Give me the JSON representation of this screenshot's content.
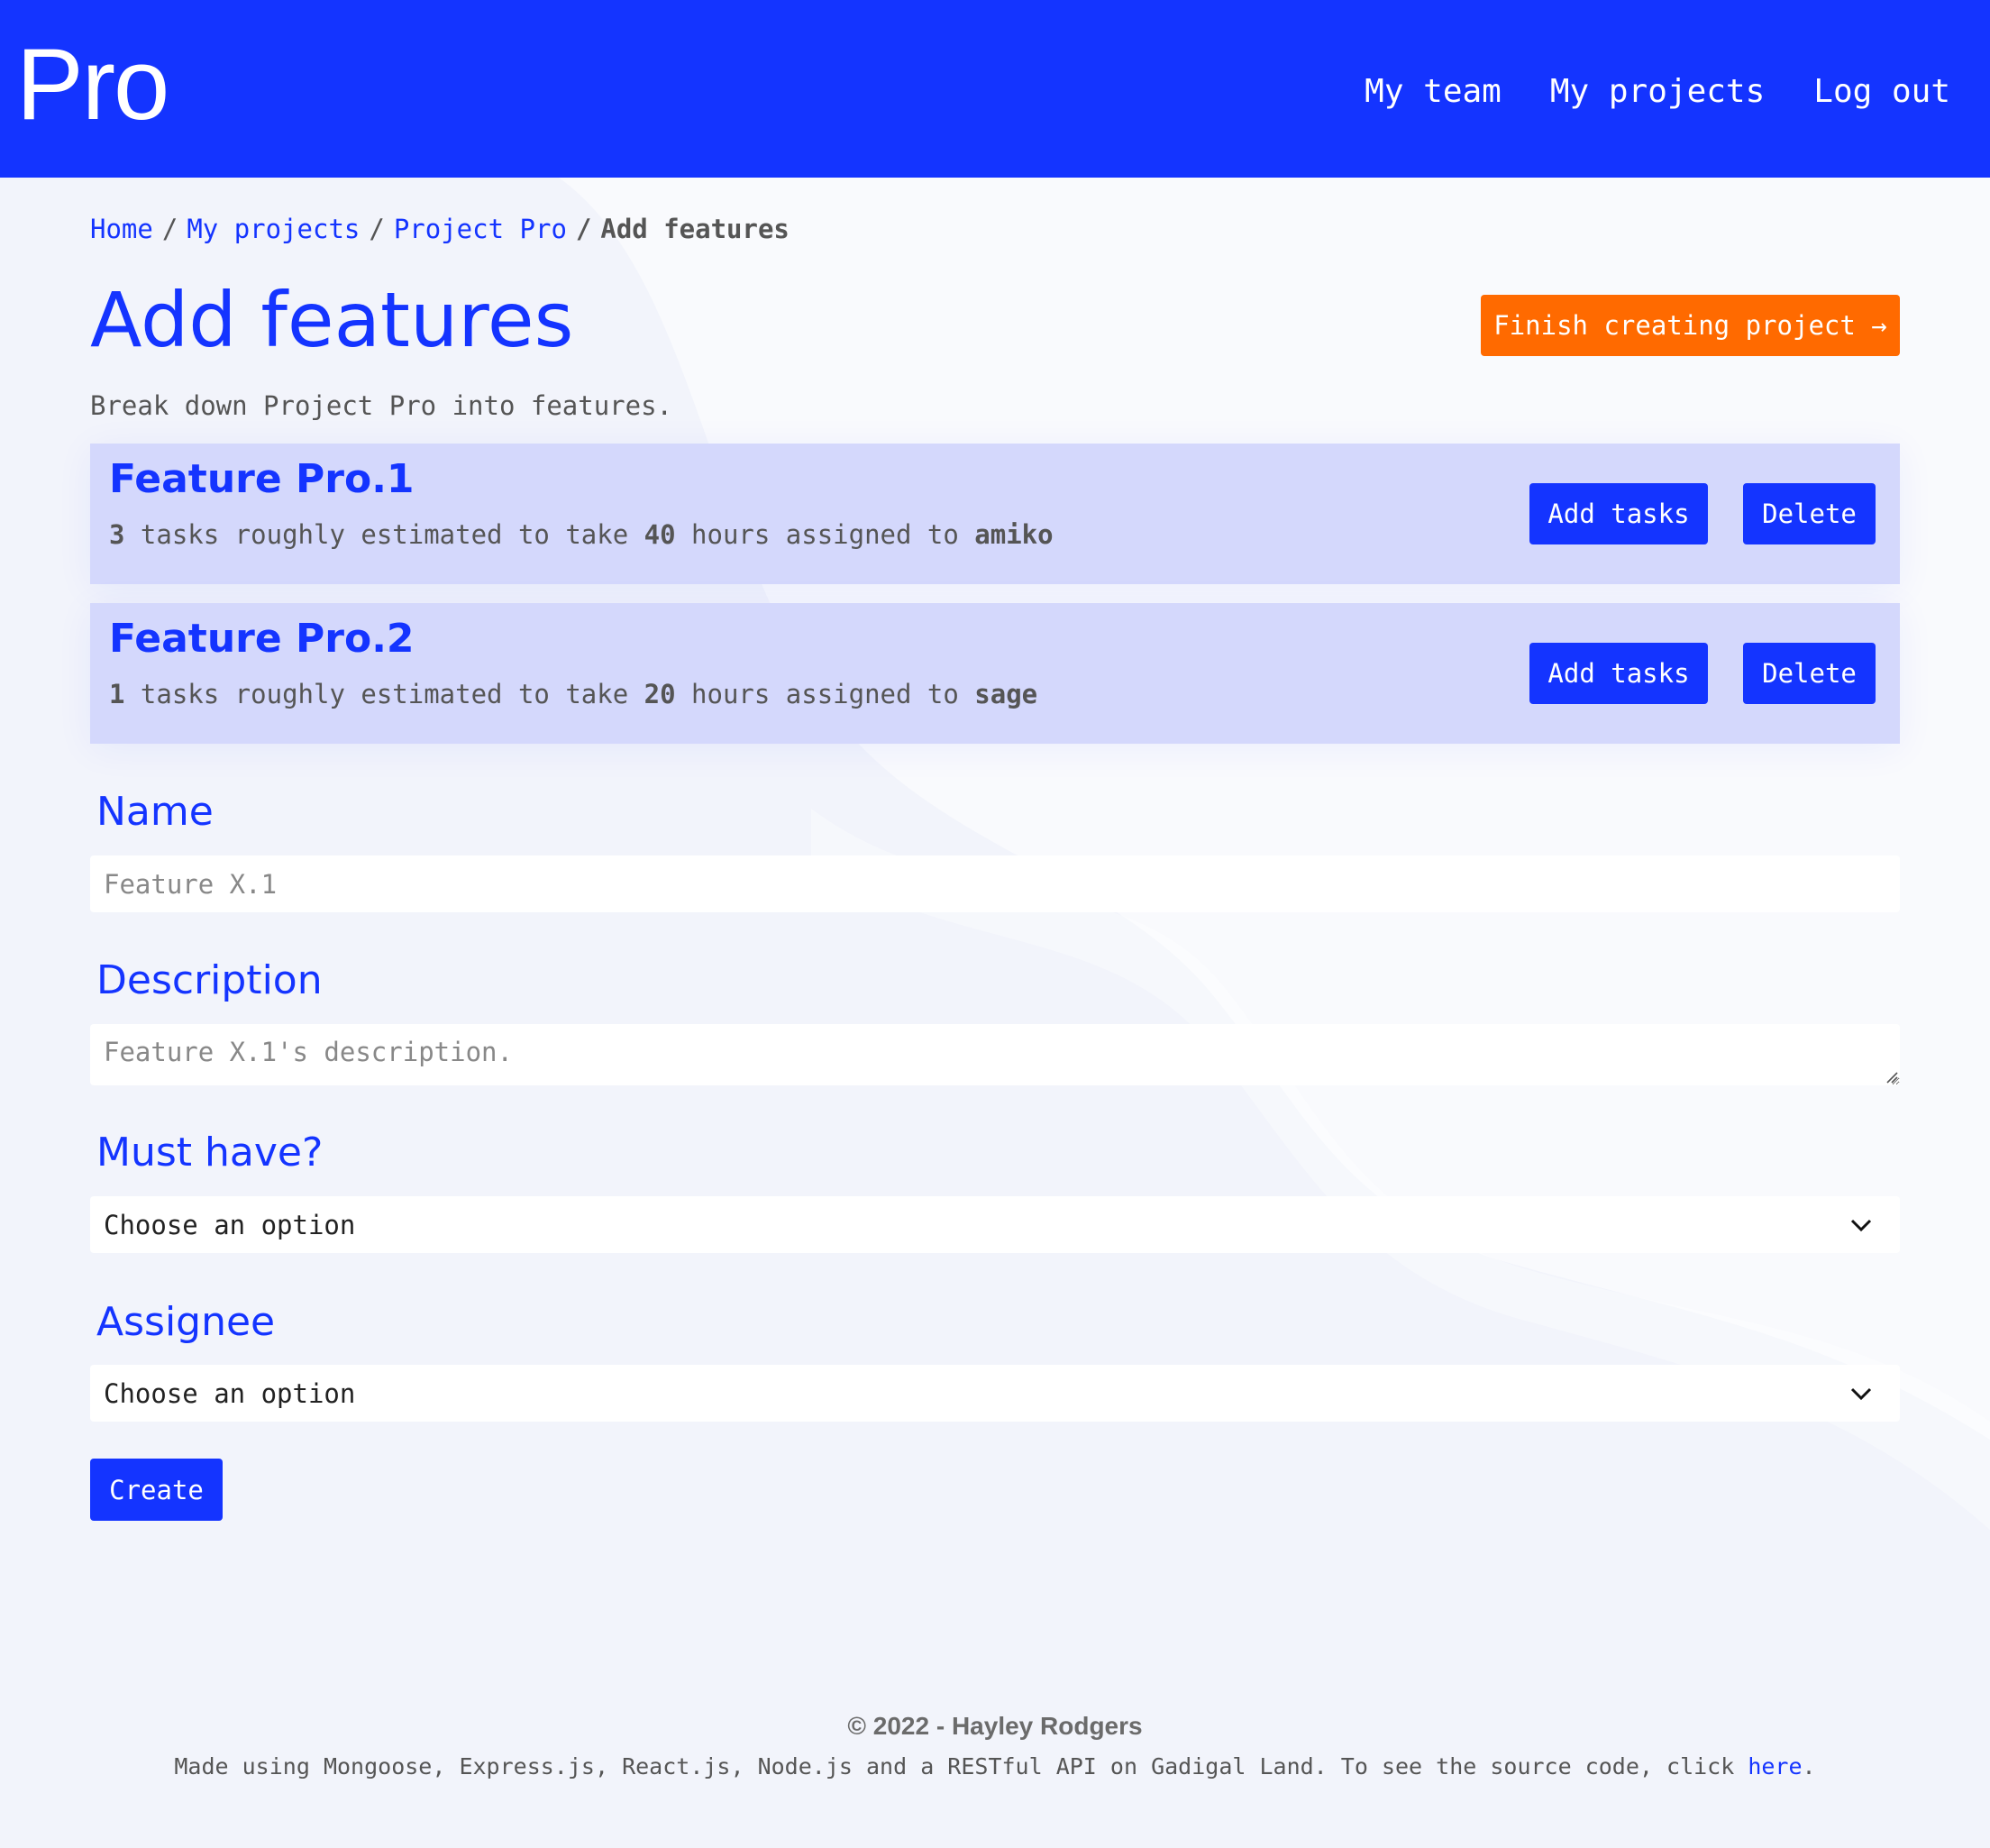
{
  "header": {
    "logo": "Pro",
    "nav": [
      "My team",
      "My projects",
      "Log out"
    ]
  },
  "breadcrumb": {
    "items": [
      "Home",
      "My projects",
      "Project Pro"
    ],
    "current": "Add features",
    "separator": "/"
  },
  "page": {
    "title": "Add features",
    "subtitle": "Break down Project Pro into features.",
    "finish_button": "Finish creating project →"
  },
  "features": [
    {
      "title": "Feature Pro.1",
      "task_count": "3",
      "text_tasks": " tasks roughly estimated to take ",
      "hours": "40",
      "text_hours": " hours assigned to ",
      "assignee": "amiko",
      "add_button": "Add tasks",
      "delete_button": "Delete"
    },
    {
      "title": "Feature Pro.2",
      "task_count": "1",
      "text_tasks": " tasks roughly estimated to take ",
      "hours": "20",
      "text_hours": " hours assigned to ",
      "assignee": "sage",
      "add_button": "Add tasks",
      "delete_button": "Delete"
    }
  ],
  "form": {
    "name_label": "Name",
    "name_placeholder": "Feature X.1",
    "description_label": "Description",
    "description_placeholder": "Feature X.1's description.",
    "must_have_label": "Must have?",
    "must_have_value": "Choose an option",
    "assignee_label": "Assignee",
    "assignee_value": "Choose an option",
    "create_button": "Create"
  },
  "footer": {
    "copyright": "© 2022 - Hayley Rodgers",
    "made_using": "Made using Mongoose, Express.js, React.js, Node.js and a RESTful API on Gadigal Land. To see the source code, click ",
    "link_text": "here",
    "period": "."
  },
  "colors": {
    "brand": "#1434ff",
    "accent": "#ff6a00",
    "card": "#d4d8fc",
    "background": "#f2f4fb"
  },
  "icons": [
    "chevron-down-icon",
    "arrow-right-icon"
  ]
}
